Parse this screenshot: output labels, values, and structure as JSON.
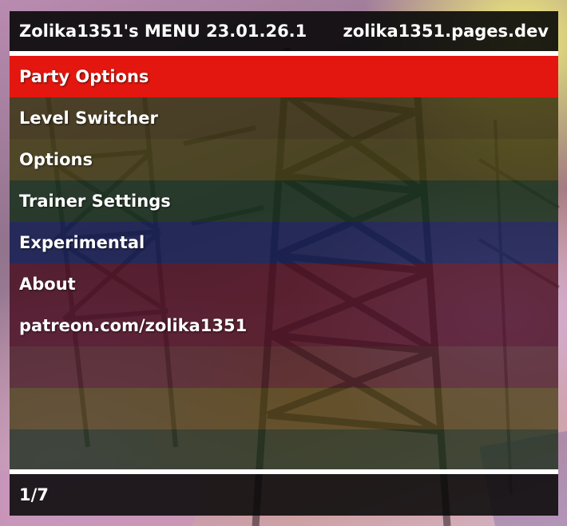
{
  "header": {
    "title": "Zolika1351's MENU 23.01.26.1",
    "website": "zolika1351.pages.dev"
  },
  "menu": {
    "selected_index": 0,
    "items": [
      {
        "label": "Party Options"
      },
      {
        "label": "Level Switcher"
      },
      {
        "label": "Options"
      },
      {
        "label": "Trainer Settings"
      },
      {
        "label": "Experimental"
      },
      {
        "label": "About"
      },
      {
        "label": "patreon.com/zolika1351"
      }
    ]
  },
  "footer": {
    "page_indicator": "1/7"
  },
  "colors": {
    "selected_highlight": "#e3170f",
    "separator": "#ffffff",
    "header_background": "#080808",
    "text": "#ffffff"
  }
}
